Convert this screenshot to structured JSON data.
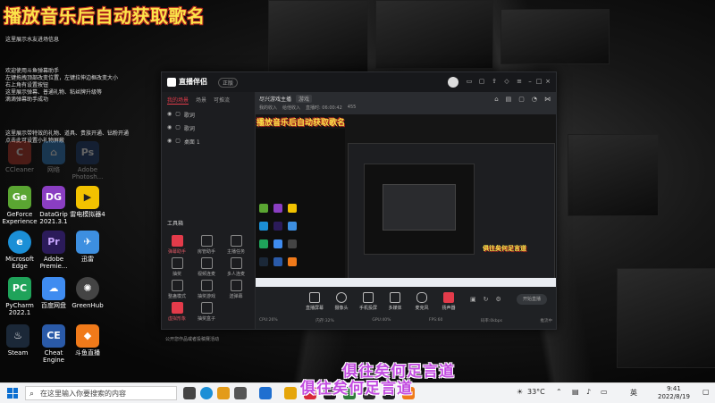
{
  "overlay_title": "播放音乐后自动获取歌名",
  "notes": {
    "line1": "这里展示水友进场信息",
    "block2": [
      "欢迎使用斗鱼弹幕助手",
      "左键拖拽顶部改变位置，左键拉伸边框改变大小",
      "右上角有设置按钮",
      "这里展示弹幕、普通礼物、粘丝牌升级等",
      "滴滴弹幕助手成功"
    ],
    "block3": [
      "这里展示带特效的礼物、道具、贵族开通、钻粉开通",
      "点击此可设置小礼物屏蔽"
    ]
  },
  "desktop_icons": [
    {
      "label": "CCleaner",
      "color": "#c0392b",
      "dim": true
    },
    {
      "label": "网络",
      "color": "#2f80c9",
      "dim": true
    },
    {
      "label": "Adobe Photosh...",
      "color": "#1b3b6f",
      "dim": true
    },
    {
      "label": "GeForce Experience",
      "color": "#5aa532",
      "text": "Ge"
    },
    {
      "label": "DataGrip 2021.3.1",
      "color": "#8a3ec2",
      "text": "DG"
    },
    {
      "label": "雷电模拟器4",
      "color": "#f2c200",
      "text": "▶"
    },
    {
      "label": "Microsoft Edge",
      "color": "#1b8fd6",
      "text": "e"
    },
    {
      "label": "Adobe Premie...",
      "color": "#2b1b5a",
      "text": "Pr"
    },
    {
      "label": "迅雷",
      "color": "#3d8fe0",
      "text": "✈"
    },
    {
      "label": "PyCharm 2022.1",
      "color": "#1fa35a",
      "text": "PC"
    },
    {
      "label": "百度网盘",
      "color": "#3f8cf0",
      "text": "☁"
    },
    {
      "label": "GreenHub",
      "color": "#444",
      "text": "✺"
    },
    {
      "label": "Steam",
      "color": "#1b2838",
      "text": "♨"
    },
    {
      "label": "Cheat Engine",
      "color": "#2a5aa8",
      "text": "CE"
    },
    {
      "label": "斗鱼直播",
      "color": "#f07a1a",
      "text": "🐟"
    }
  ],
  "app": {
    "logo": "直播伴侣",
    "version": "正版",
    "left_tabs": [
      "我的场景",
      "场景",
      "可推流"
    ],
    "scenes": [
      "歌词",
      "歌词",
      "桌面 1"
    ],
    "tools_title": "工具箱",
    "tools": [
      "弹幕助手",
      "房管助手",
      "主播任务",
      "抽奖",
      "视频连麦",
      "多人连麦",
      "整蛊模式",
      "抽奖游戏",
      "送弹幕",
      "虚拟形象",
      "抽奖盒子"
    ],
    "bottom_tip": "公开您作品或者投稿赛活动",
    "room_title": "尽兴游戏主播",
    "room_tag": "游戏",
    "meta": [
      "我的收入",
      "给他收入",
      "直播时: 06:00:42",
      "455"
    ],
    "bottom_buttons": [
      "直播屏幕",
      "摄像头",
      "手机投屏",
      "多媒体",
      "麦克风",
      "扬声器"
    ],
    "start_live": "开始直播",
    "status": [
      "CPU:26%",
      "内存:32%",
      "GPU:40%",
      "FPS:60",
      "码率:0kbps",
      "推流中"
    ]
  },
  "inner_subtitle": "俱往矣何足言道",
  "subtitles": [
    "俱往矣何足言道",
    "俱往矣何足言道"
  ],
  "taskbar": {
    "search_placeholder": "在这里输入你要搜索的内容",
    "weather": "33°C",
    "ime": "英",
    "time": "9:41",
    "date": "2022/8/19"
  }
}
